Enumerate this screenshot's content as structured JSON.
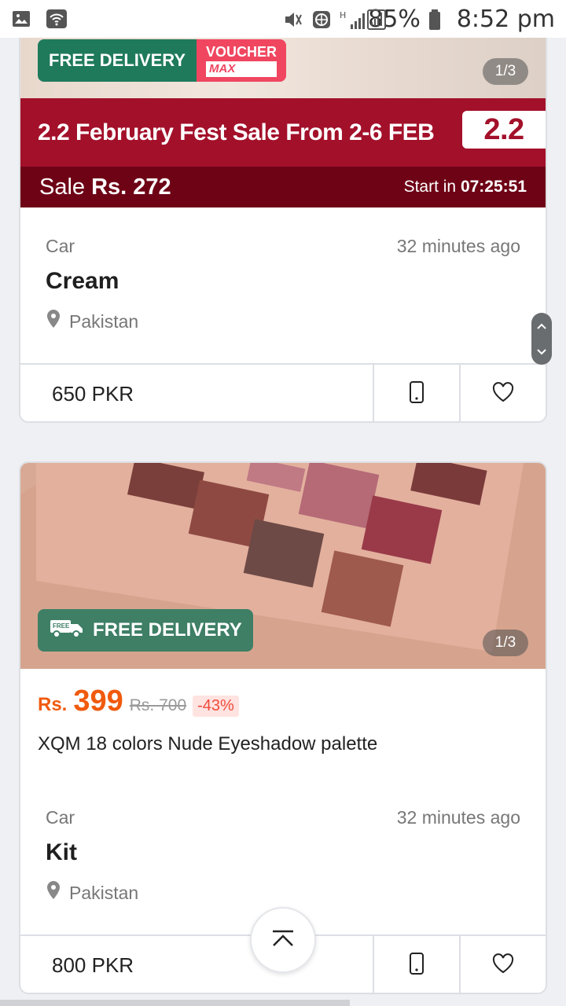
{
  "status_bar": {
    "battery": "85%",
    "time": "8:52 pm"
  },
  "listing1": {
    "banner": {
      "free_delivery": "FREE DELIVERY",
      "voucher": "VOUCHER",
      "max": "MAX",
      "pager": "1/3",
      "fest_text": "2.2 February Fest Sale From 2-6 FEB",
      "fest_badge": "2.2",
      "sale_label": "Sale",
      "sale_price": "Rs. 272",
      "start_label": "Start in",
      "countdown": "07:25:51"
    },
    "category": "Car",
    "time": "32 minutes ago",
    "title": "Cream",
    "location": "Pakistan",
    "price": "650 PKR"
  },
  "listing2": {
    "banner": {
      "free_delivery": "FREE DELIVERY",
      "truck_tag": "FREE",
      "pager": "1/3",
      "price_currency": "Rs.",
      "price_value": "399",
      "old_price": "Rs. 700",
      "discount": "-43%",
      "product_title": "XQM 18 colors Nude Eyeshadow palette"
    },
    "category": "Car",
    "time": "32 minutes ago",
    "title": "Kit",
    "location": "Pakistan",
    "price": "800 PKR"
  },
  "colors": {
    "fest_red": "#a3102a",
    "sale_bar": "#6e0316",
    "free_delivery_green": "#1f7a5c",
    "promo_orange": "#f05a0d"
  }
}
